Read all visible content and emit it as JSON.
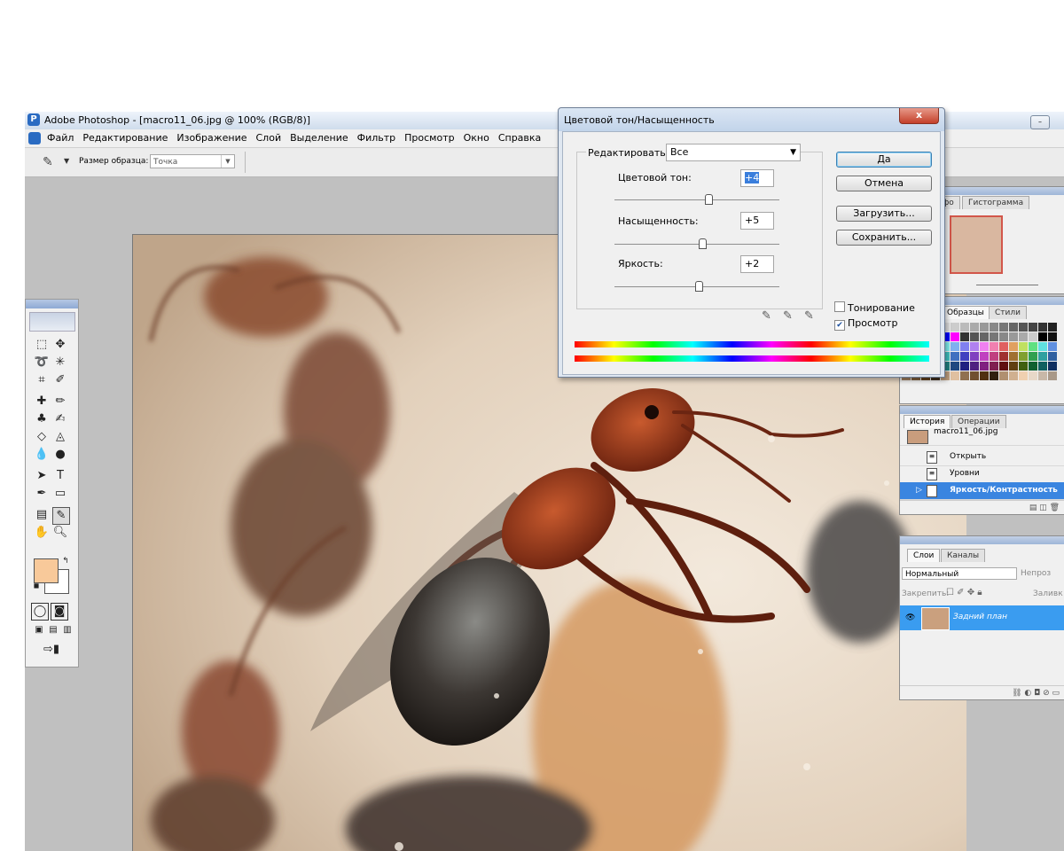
{
  "app": {
    "title": "Adobe Photoshop - [macro11_06.jpg @ 100% (RGB/8)]",
    "menu": [
      "Файл",
      "Редактирование",
      "Изображение",
      "Слой",
      "Выделение",
      "Фильтр",
      "Просмотр",
      "Окно",
      "Справка"
    ]
  },
  "options_bar": {
    "sample_size_label": "Размер образца:",
    "sample_size_value": "Точка"
  },
  "dialog": {
    "title": "Цветовой тон/Насыщенность",
    "close_label": "x",
    "edit_label": "Редактировать:",
    "edit_value": "Все",
    "sliders": [
      {
        "label": "Цветовой тон:",
        "value": "+4",
        "position": 0.57
      },
      {
        "label": "Насыщенность:",
        "value": "+5",
        "position": 0.53
      },
      {
        "label": "Яркость:",
        "value": "+2",
        "position": 0.51
      }
    ],
    "buttons": {
      "ok": "Да",
      "cancel": "Отмена",
      "load": "Загрузить...",
      "save": "Сохранить..."
    },
    "colorize_label": "Тонирование",
    "colorize_checked": false,
    "preview_label": "Просмотр",
    "preview_checked": true
  },
  "navigator_panel": {
    "tabs": [
      "ор",
      "Инфо",
      "Гистограмма"
    ]
  },
  "swatches_panel": {
    "tabs": [
      "Образцы",
      "Стили"
    ]
  },
  "history_panel": {
    "tabs": [
      "История",
      "Операции"
    ],
    "snapshot": "macro11_06.jpg",
    "items": [
      "Открыть",
      "Уровни",
      "Яркость/Контрастность"
    ],
    "selected_index": 2
  },
  "layers_panel": {
    "tabs": [
      "Слои",
      "Каналы"
    ],
    "blend_mode": "Нормальный",
    "opacity_label": "Непроз",
    "lock_label": "Закрепить:",
    "fill_label": "Заливк",
    "layer_name": "Задний план"
  },
  "colors": {
    "foreground": "#f8c99a",
    "background": "#ffffff",
    "selection": "#3a85e0"
  }
}
